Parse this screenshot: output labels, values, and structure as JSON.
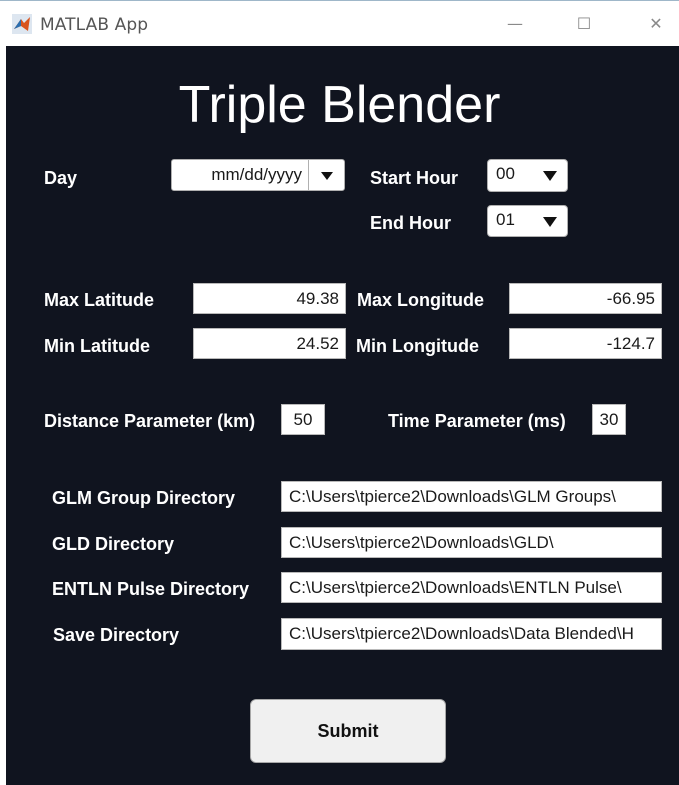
{
  "window": {
    "title": "MATLAB App",
    "minimize_glyph": "—",
    "maximize_glyph": "☐",
    "close_glyph": "✕"
  },
  "app": {
    "heading": "Triple Blender"
  },
  "day": {
    "label": "Day",
    "placeholder": "mm/dd/yyyy"
  },
  "start_hour": {
    "label": "Start Hour",
    "value": "00"
  },
  "end_hour": {
    "label": "End Hour",
    "value": "01"
  },
  "max_latitude": {
    "label": "Max Latitude",
    "value": "49.38"
  },
  "min_latitude": {
    "label": "Min Latitude",
    "value": "24.52"
  },
  "max_longitude": {
    "label": "Max Longitude",
    "value": "-66.95"
  },
  "min_longitude": {
    "label": "Min Longitude",
    "value": "-124.7"
  },
  "distance_parameter": {
    "label": "Distance Parameter (km)",
    "value": "50"
  },
  "time_parameter": {
    "label": "Time Parameter (ms)",
    "value": "30"
  },
  "directories": {
    "glm_group": {
      "label": "GLM Group Directory",
      "value": "C:\\Users\\tpierce2\\Downloads\\GLM Groups\\"
    },
    "gld": {
      "label": "GLD Directory",
      "value": "C:\\Users\\tpierce2\\Downloads\\GLD\\"
    },
    "entln_pulse": {
      "label": "ENTLN Pulse Directory",
      "value": "C:\\Users\\tpierce2\\Downloads\\ENTLN Pulse\\"
    },
    "save": {
      "label": "Save Directory",
      "value": "C:\\Users\\tpierce2\\Downloads\\Data Blended\\H"
    }
  },
  "submit": {
    "label": "Submit"
  },
  "colors": {
    "background": "#10141f",
    "text": "#ffffff",
    "field": "#ffffff"
  }
}
